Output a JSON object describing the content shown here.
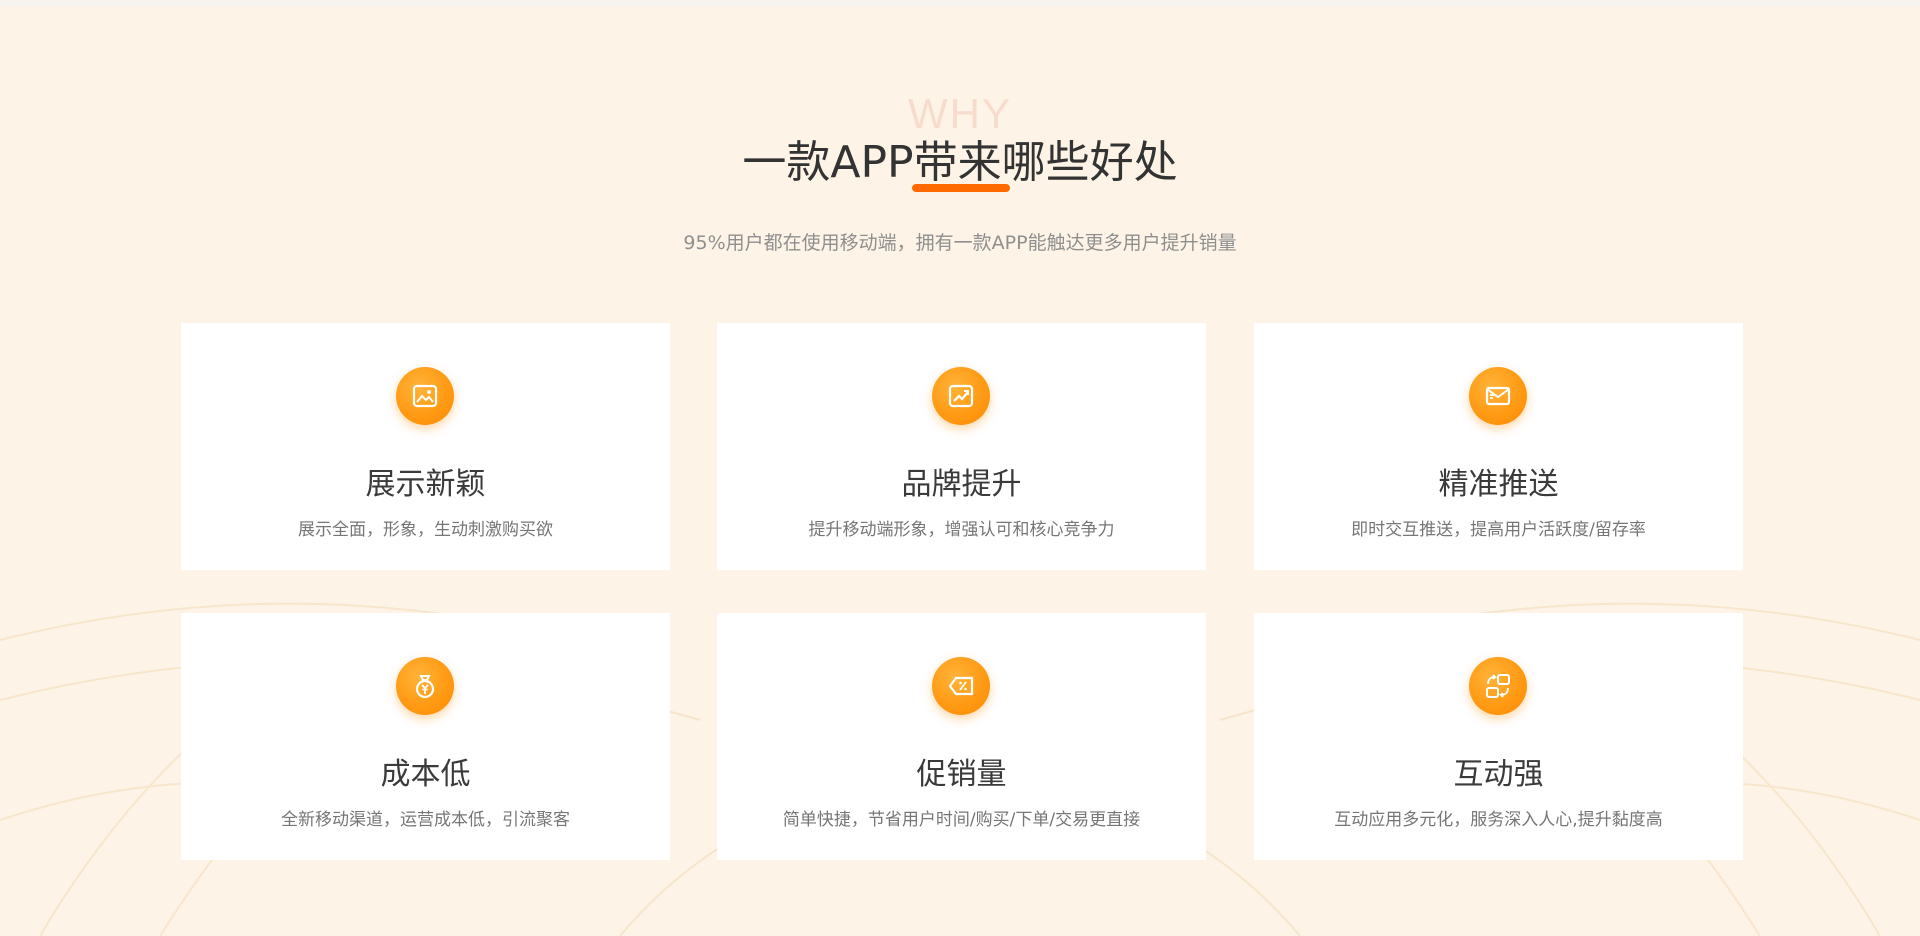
{
  "section": {
    "watermark": "WHY",
    "title": "一款APP带来哪些好处",
    "subtitle": "95%用户都在使用移动端，拥有一款APP能触达更多用户提升销量"
  },
  "colors": {
    "accent": "#ff6a00",
    "icon_orange": "#ff9a14",
    "background": "#fdf4e7"
  },
  "features": [
    {
      "icon": "image-icon",
      "title": "展示新颖",
      "desc": "展示全面，形象，生动刺激购买欲"
    },
    {
      "icon": "growth-chart-icon",
      "title": "品牌提升",
      "desc": "提升移动端形象，增强认可和核心竞争力"
    },
    {
      "icon": "envelope-icon",
      "title": "精准推送",
      "desc": "即时交互推送，提高用户活跃度/留存率"
    },
    {
      "icon": "money-bag-icon",
      "title": "成本低",
      "desc": "全新移动渠道，运营成本低，引流聚客"
    },
    {
      "icon": "discount-tag-icon",
      "title": "促销量",
      "desc": "简单快捷，节省用户时间/购买/下单/交易更直接"
    },
    {
      "icon": "interaction-icon",
      "title": "互动强",
      "desc": "互动应用多元化，服务深入人心,提升黏度高"
    }
  ]
}
